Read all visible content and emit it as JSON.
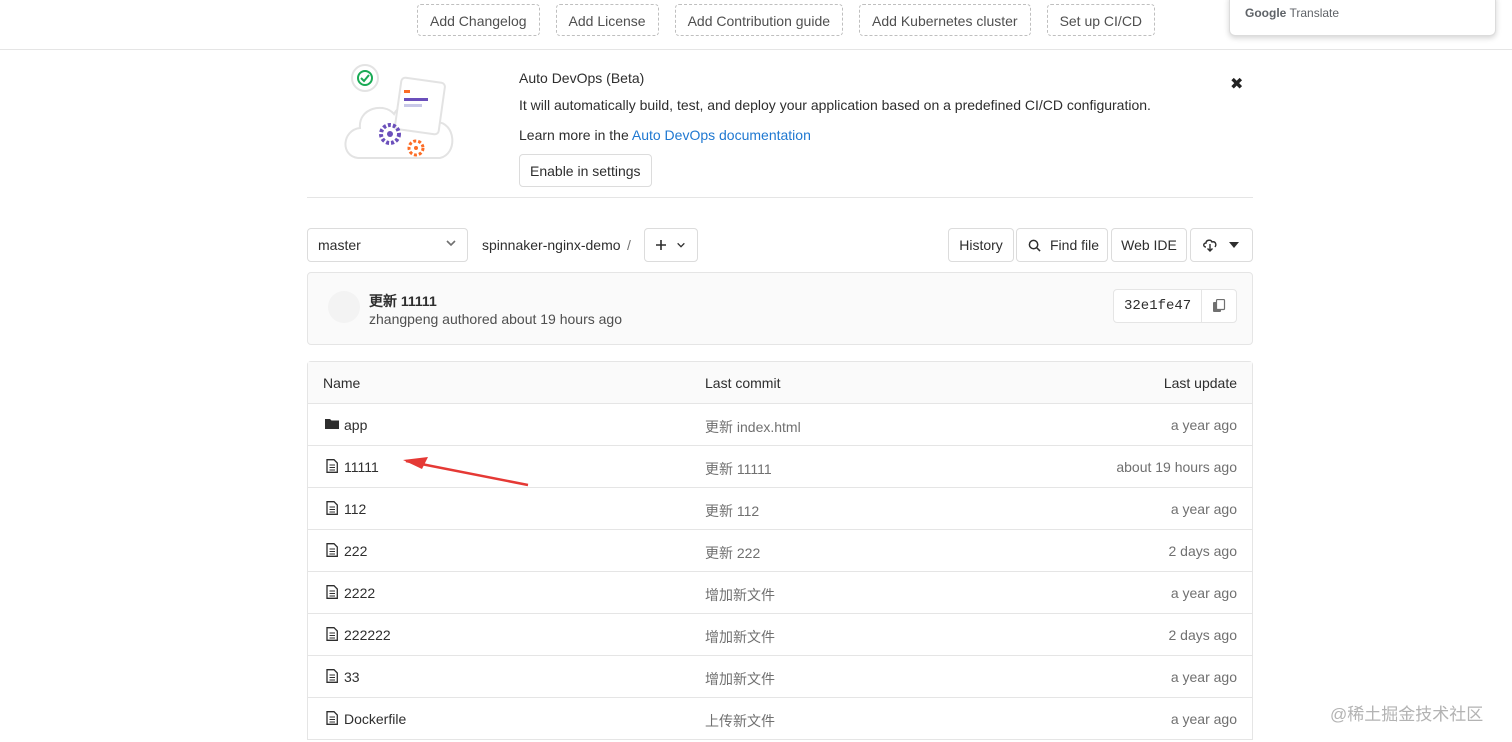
{
  "top_actions": [
    "Add Changelog",
    "Add License",
    "Add Contribution guide",
    "Add Kubernetes cluster",
    "Set up CI/CD"
  ],
  "google_translate": {
    "brand_a": "Google",
    "brand_b": "Translate"
  },
  "banner": {
    "title": "Auto DevOps (Beta)",
    "description": "It will automatically build, test, and deploy your application based on a predefined CI/CD configuration.",
    "learn_prefix": "Learn more in the ",
    "learn_link": "Auto DevOps documentation",
    "enable_button": "Enable in settings",
    "close_icon": "close-icon"
  },
  "repo_nav": {
    "branch": "master",
    "breadcrumb": "spinnaker-nginx-demo",
    "separator": "/",
    "history": "History",
    "find_file": "Find file",
    "web_ide": "Web IDE"
  },
  "last_commit": {
    "title": "更新 11111",
    "meta": "zhangpeng authored about 19 hours ago",
    "sha": "32e1fe47"
  },
  "tree": {
    "headers": {
      "name": "Name",
      "last_commit": "Last commit",
      "last_update": "Last update"
    },
    "rows": [
      {
        "type": "folder",
        "name": "app",
        "commit": "更新 index.html",
        "updated": "a year ago"
      },
      {
        "type": "file",
        "name": "11111",
        "commit": "更新 11111",
        "updated": "about 19 hours ago"
      },
      {
        "type": "file",
        "name": "112",
        "commit": "更新 112",
        "updated": "a year ago"
      },
      {
        "type": "file",
        "name": "222",
        "commit": "更新 222",
        "updated": "2 days ago"
      },
      {
        "type": "file",
        "name": "2222",
        "commit": "增加新文件",
        "updated": "a year ago"
      },
      {
        "type": "file",
        "name": "222222",
        "commit": "增加新文件",
        "updated": "2 days ago"
      },
      {
        "type": "file",
        "name": "33",
        "commit": "增加新文件",
        "updated": "a year ago"
      },
      {
        "type": "file",
        "name": "Dockerfile",
        "commit": "上传新文件",
        "updated": "a year ago"
      }
    ]
  },
  "watermark": "@稀土掘金技术社区",
  "colors": {
    "link": "#1f78d1",
    "annotation_arrow": "#e53935"
  }
}
